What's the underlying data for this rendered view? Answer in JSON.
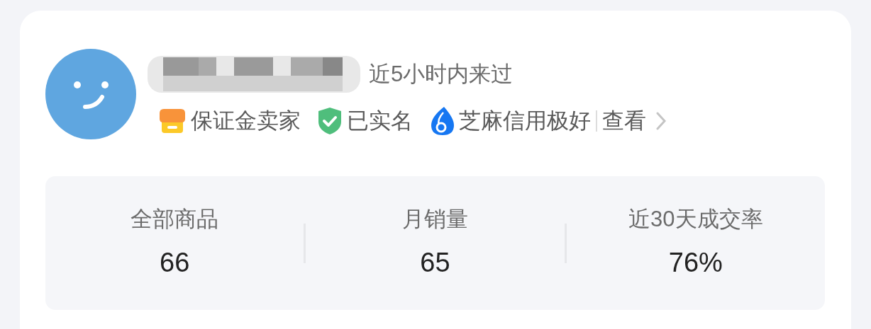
{
  "seller": {
    "last_seen": "近5小时内来过",
    "badges": [
      {
        "kind": "deposit",
        "label": "保证金卖家"
      },
      {
        "kind": "verified",
        "label": "已实名"
      },
      {
        "kind": "credit",
        "label": "芝麻信用极好"
      }
    ],
    "view_link": "查看"
  },
  "stats": [
    {
      "label": "全部商品",
      "value": "66"
    },
    {
      "label": "月销量",
      "value": "65"
    },
    {
      "label": "近30天成交率",
      "value": "76%"
    }
  ]
}
